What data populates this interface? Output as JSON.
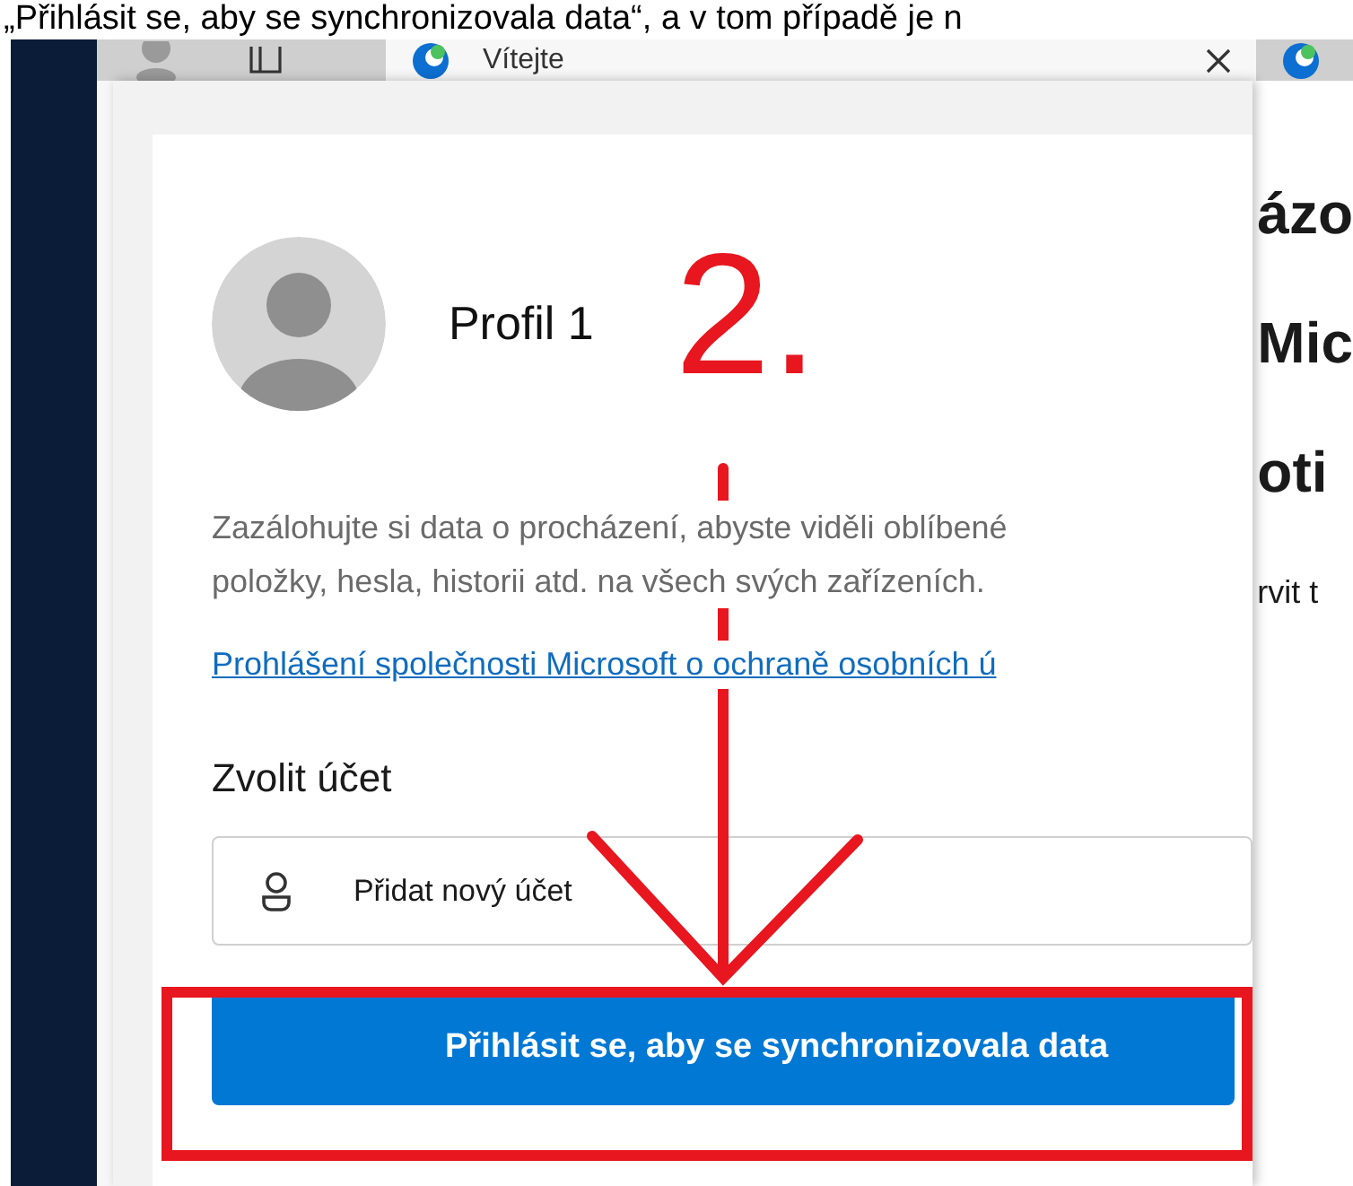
{
  "caption": "„Přihlásit se, aby se synchronizovala data“, a v tom případě je n",
  "tabs": [
    {
      "label": "Vítejte",
      "selected": true
    },
    {
      "selected": false
    }
  ],
  "profile": {
    "name": "Profil 1",
    "description": "Zazálohujte si data o procházení, abyste viděli oblíbené\npoložky, hesla, historii atd. na všech svých zařízeních.",
    "privacy_link": "Prohlášení společnosti Microsoft o ochraně osobních ú",
    "choose_account_heading": "Zvolit účet",
    "add_account": "Přidat nový účet",
    "sign_in_button": "Přihlásit se, aby se synchronizovala data"
  },
  "annotation": {
    "step": "2."
  },
  "background_page": {
    "lines": [
      "ázo",
      "Mic",
      "oti",
      "rvit t"
    ]
  }
}
